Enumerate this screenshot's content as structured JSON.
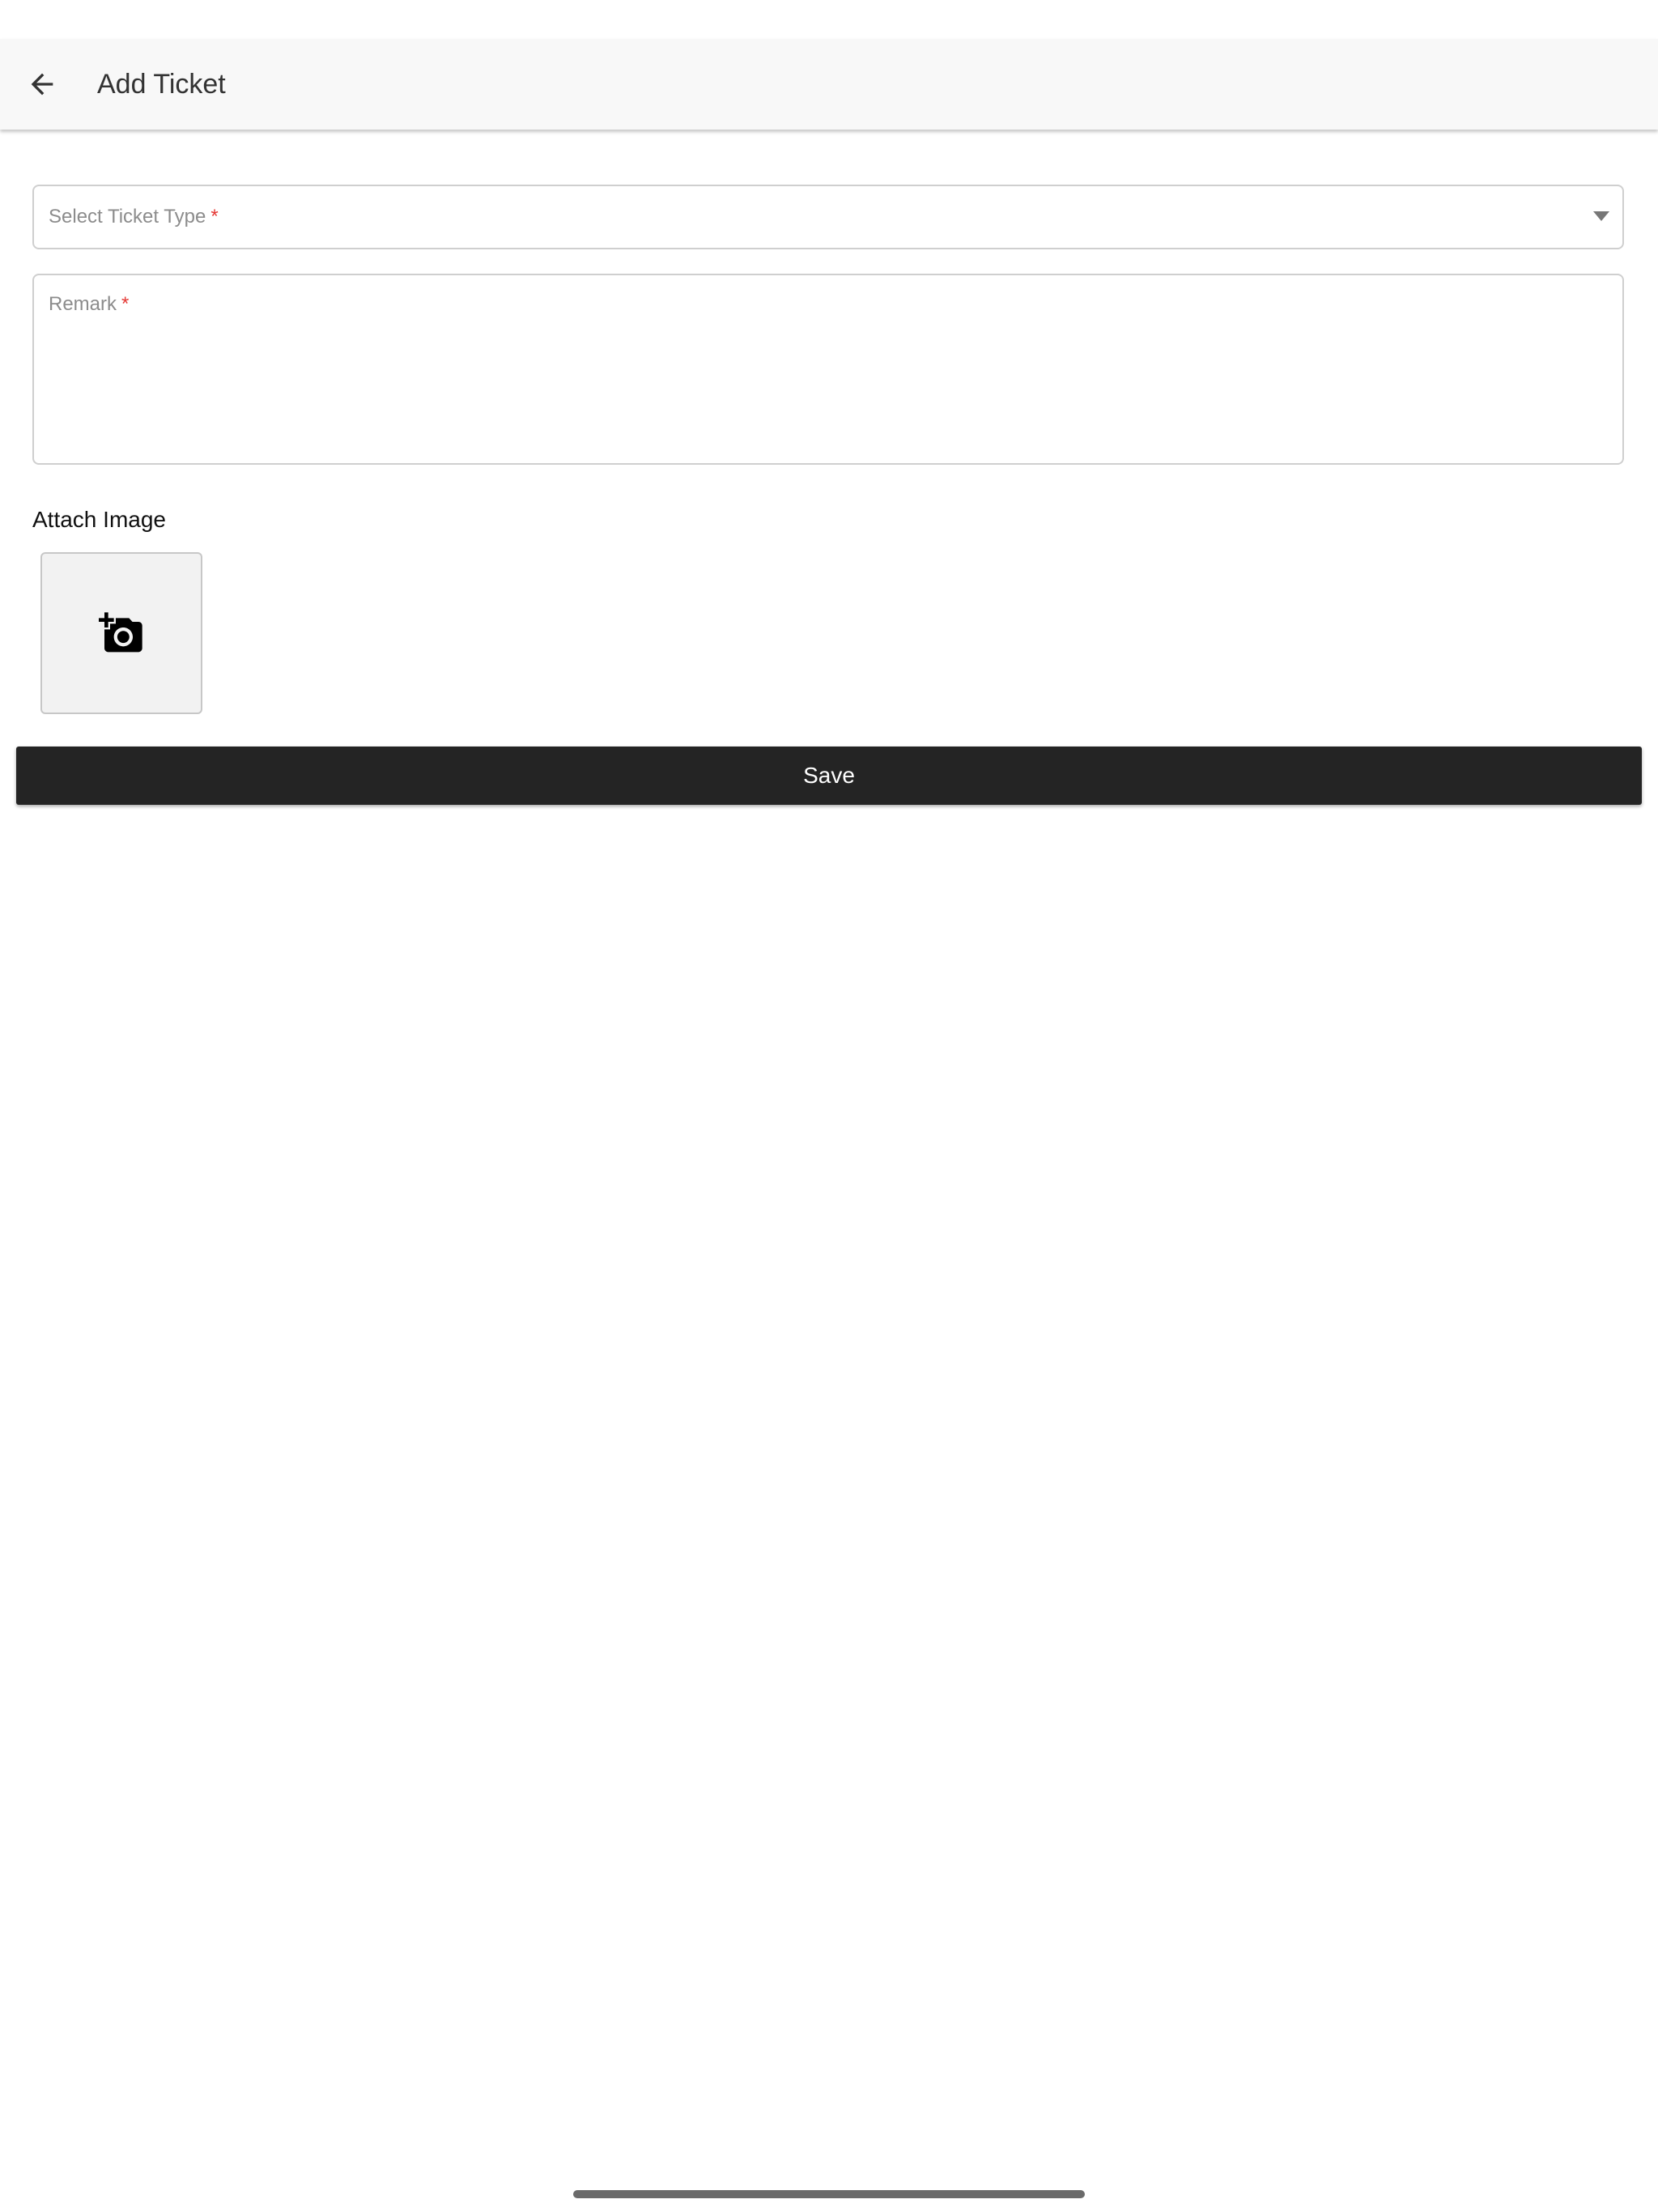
{
  "header": {
    "back_icon": "arrow-left-icon",
    "title": "Add Ticket"
  },
  "form": {
    "ticket_type": {
      "label": "Select Ticket Type",
      "required_mark": "*",
      "value": "",
      "icon": "dropdown-arrow-icon"
    },
    "remark": {
      "label": "Remark",
      "required_mark": "*",
      "value": ""
    },
    "attach": {
      "label": "Attach Image",
      "icon": "add-photo-icon"
    },
    "save_label": "Save"
  },
  "colors": {
    "app_bar_bg": "#f8f8f8",
    "button_bg": "#242424",
    "required": "#e53935",
    "label": "#8c8c8c",
    "border": "#cfcfcf"
  }
}
